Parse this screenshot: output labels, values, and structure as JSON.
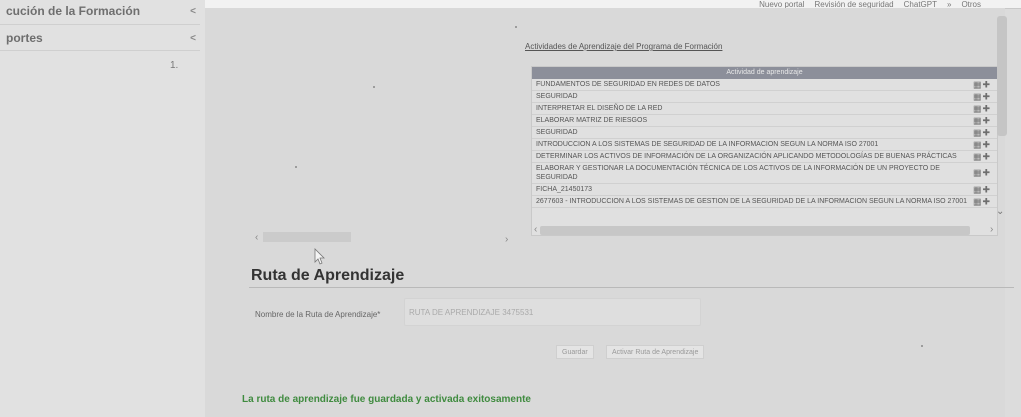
{
  "browser": {
    "bookmarks": [
      "Nuevo portal",
      "Revisión de seguridad",
      "ChatGPT"
    ],
    "overflow": "»",
    "other_folder": "Otros"
  },
  "sidebar": {
    "items": [
      {
        "label": "cución de la Formación",
        "chevron": "<"
      },
      {
        "label": "portes",
        "chevron": "<"
      }
    ],
    "number": "1."
  },
  "section": {
    "link": "Actividades de Aprendizaje del Programa de Formación"
  },
  "activities": {
    "header": "Actividad de aprendizaje",
    "rows": [
      "FUNDAMENTOS DE SEGURIDAD EN REDES DE DATOS",
      "SEGURIDAD",
      "INTERPRETAR EL DISEÑO DE LA RED",
      "ELABORAR MATRIZ DE RIESGOS",
      "SEGURIDAD",
      "INTRODUCCION A LOS SISTEMAS DE SEGURIDAD DE LA INFORMACION SEGUN LA NORMA ISO 27001",
      "DETERMINAR LOS ACTIVOS DE INFORMACIÓN DE LA ORGANIZACIÓN APLICANDO METODOLOGÍAS DE BUENAS PRÁCTICAS",
      "ELABORAR Y GESTIONAR LA DOCUMENTACIÓN TÉCNICA DE LOS ACTIVOS DE LA INFORMACIÓN DE UN PROYECTO DE SEGURIDAD",
      "FICHA_21450173",
      "2677603 - INTRODUCCION A LOS SISTEMAS DE GESTION DE LA SEGURIDAD DE LA INFORMACION SEGUN LA NORMA ISO 27001"
    ],
    "row_tools": "▦✚"
  },
  "ruta": {
    "title": "Ruta de Aprendizaje",
    "name_label": "Nombre de la Ruta de Aprendizaje*",
    "name_value": "RUTA DE APRENDIZAJE 3475531",
    "save_label": "Guardar",
    "activate_label": "Activar Ruta de Aprendizaje",
    "success": "La ruta de aprendizaje fue guardada y activada exitosamente"
  },
  "icons": {
    "chevron_left": "‹",
    "chevron_right": "›",
    "chevron_down": "⌄"
  }
}
